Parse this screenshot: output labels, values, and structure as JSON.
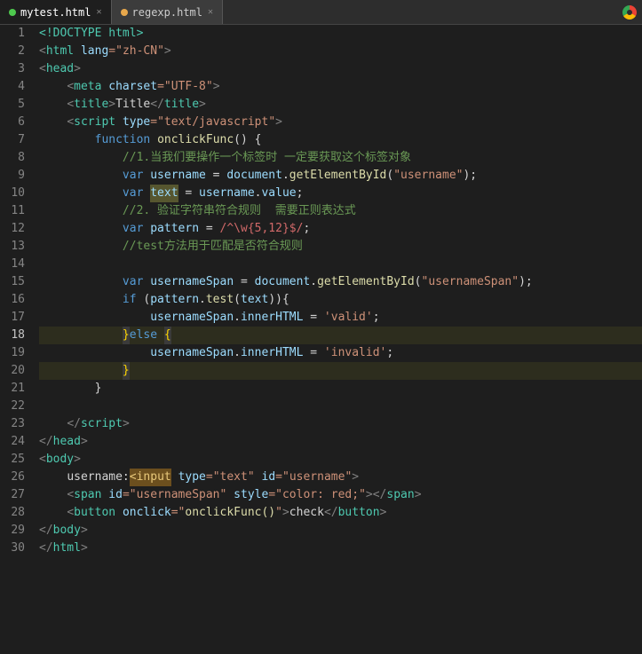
{
  "tabs": [
    {
      "label": "mytest.html",
      "active": true,
      "dot_color": "green"
    },
    {
      "label": "regexp.html",
      "active": false,
      "dot_color": "orange"
    }
  ],
  "lines": [
    {
      "num": 1,
      "tokens": [
        {
          "t": "<!DOCTYPE html>",
          "c": "tag"
        }
      ]
    },
    {
      "num": 2,
      "tokens": [
        {
          "t": "<",
          "c": "tag-bracket"
        },
        {
          "t": "html",
          "c": "tag"
        },
        {
          "t": " ",
          "c": "plain"
        },
        {
          "t": "lang",
          "c": "attr"
        },
        {
          "t": "=\"",
          "c": "str"
        },
        {
          "t": "zh-CN",
          "c": "str"
        },
        {
          "t": "\"",
          "c": "str"
        },
        {
          "t": ">",
          "c": "tag-bracket"
        }
      ]
    },
    {
      "num": 3,
      "tokens": [
        {
          "t": "<",
          "c": "tag-bracket"
        },
        {
          "t": "head",
          "c": "tag"
        },
        {
          "t": ">",
          "c": "tag-bracket"
        }
      ]
    },
    {
      "num": 4,
      "tokens": [
        {
          "t": "    ",
          "c": "plain"
        },
        {
          "t": "<",
          "c": "tag-bracket"
        },
        {
          "t": "meta",
          "c": "tag"
        },
        {
          "t": " ",
          "c": "plain"
        },
        {
          "t": "charset",
          "c": "attr"
        },
        {
          "t": "=\"",
          "c": "str"
        },
        {
          "t": "UTF-8",
          "c": "str"
        },
        {
          "t": "\"",
          "c": "str"
        },
        {
          "t": ">",
          "c": "tag-bracket"
        }
      ]
    },
    {
      "num": 5,
      "tokens": [
        {
          "t": "    ",
          "c": "plain"
        },
        {
          "t": "<",
          "c": "tag-bracket"
        },
        {
          "t": "title",
          "c": "tag"
        },
        {
          "t": ">",
          "c": "tag-bracket"
        },
        {
          "t": "Title",
          "c": "plain"
        },
        {
          "t": "</",
          "c": "tag-bracket"
        },
        {
          "t": "title",
          "c": "tag"
        },
        {
          "t": ">",
          "c": "tag-bracket"
        }
      ]
    },
    {
      "num": 6,
      "tokens": [
        {
          "t": "    ",
          "c": "plain"
        },
        {
          "t": "<",
          "c": "tag-bracket"
        },
        {
          "t": "script",
          "c": "tag"
        },
        {
          "t": " ",
          "c": "plain"
        },
        {
          "t": "type",
          "c": "attr"
        },
        {
          "t": "=\"",
          "c": "str"
        },
        {
          "t": "text/javascript",
          "c": "str"
        },
        {
          "t": "\"",
          "c": "str"
        },
        {
          "t": ">",
          "c": "tag-bracket"
        }
      ]
    },
    {
      "num": 7,
      "tokens": [
        {
          "t": "        ",
          "c": "plain"
        },
        {
          "t": "function",
          "c": "kw"
        },
        {
          "t": " ",
          "c": "plain"
        },
        {
          "t": "onclickFunc",
          "c": "fn"
        },
        {
          "t": "() {",
          "c": "plain"
        }
      ]
    },
    {
      "num": 8,
      "tokens": [
        {
          "t": "            ",
          "c": "plain"
        },
        {
          "t": "//1.当我们要操作一个标签时 一定要获取这个标签对象",
          "c": "comment-cn"
        }
      ]
    },
    {
      "num": 9,
      "tokens": [
        {
          "t": "            ",
          "c": "plain"
        },
        {
          "t": "var",
          "c": "kw"
        },
        {
          "t": " ",
          "c": "plain"
        },
        {
          "t": "username",
          "c": "var-name"
        },
        {
          "t": " = ",
          "c": "plain"
        },
        {
          "t": "document",
          "c": "var-name"
        },
        {
          "t": ".",
          "c": "plain"
        },
        {
          "t": "getElementById",
          "c": "method"
        },
        {
          "t": "(",
          "c": "plain"
        },
        {
          "t": "\"username\"",
          "c": "str"
        },
        {
          "t": ");",
          "c": "plain"
        }
      ]
    },
    {
      "num": 10,
      "tokens": [
        {
          "t": "            ",
          "c": "plain"
        },
        {
          "t": "var",
          "c": "kw"
        },
        {
          "t": " ",
          "c": "plain"
        },
        {
          "t": "text",
          "c": "var-name",
          "highlight": "yellow"
        },
        {
          "t": " = ",
          "c": "plain"
        },
        {
          "t": "username",
          "c": "var-name"
        },
        {
          "t": ".",
          "c": "plain"
        },
        {
          "t": "value",
          "c": "prop"
        },
        {
          "t": ";",
          "c": "plain"
        }
      ]
    },
    {
      "num": 11,
      "tokens": [
        {
          "t": "            ",
          "c": "plain"
        },
        {
          "t": "//2. 验证字符串符合规则  需要正则表达式",
          "c": "comment-cn"
        }
      ]
    },
    {
      "num": 12,
      "tokens": [
        {
          "t": "            ",
          "c": "plain"
        },
        {
          "t": "var",
          "c": "kw"
        },
        {
          "t": " ",
          "c": "plain"
        },
        {
          "t": "pattern",
          "c": "var-name"
        },
        {
          "t": " = ",
          "c": "plain"
        },
        {
          "t": "/^\\w{5,12}$/",
          "c": "regex"
        },
        {
          "t": ";",
          "c": "plain"
        }
      ]
    },
    {
      "num": 13,
      "tokens": [
        {
          "t": "            ",
          "c": "plain"
        },
        {
          "t": "//test方法用于匹配是否符合规则",
          "c": "comment-cn"
        }
      ]
    },
    {
      "num": 14,
      "tokens": []
    },
    {
      "num": 15,
      "tokens": [
        {
          "t": "            ",
          "c": "plain"
        },
        {
          "t": "var",
          "c": "kw"
        },
        {
          "t": " ",
          "c": "plain"
        },
        {
          "t": "usernameSpan",
          "c": "var-name"
        },
        {
          "t": " = ",
          "c": "plain"
        },
        {
          "t": "document",
          "c": "var-name"
        },
        {
          "t": ".",
          "c": "plain"
        },
        {
          "t": "getElementById",
          "c": "method"
        },
        {
          "t": "(",
          "c": "plain"
        },
        {
          "t": "\"usernameSpan\"",
          "c": "str"
        },
        {
          "t": ");",
          "c": "plain"
        }
      ]
    },
    {
      "num": 16,
      "tokens": [
        {
          "t": "            ",
          "c": "plain"
        },
        {
          "t": "if",
          "c": "kw"
        },
        {
          "t": " (",
          "c": "plain"
        },
        {
          "t": "pattern",
          "c": "var-name"
        },
        {
          "t": ".",
          "c": "plain"
        },
        {
          "t": "test",
          "c": "method"
        },
        {
          "t": "(",
          "c": "plain"
        },
        {
          "t": "text",
          "c": "var-name"
        },
        {
          "t": ")){",
          "c": "plain"
        }
      ]
    },
    {
      "num": 17,
      "tokens": [
        {
          "t": "                ",
          "c": "plain"
        },
        {
          "t": "usernameSpan",
          "c": "var-name"
        },
        {
          "t": ".",
          "c": "plain"
        },
        {
          "t": "innerHTML",
          "c": "prop"
        },
        {
          "t": " = ",
          "c": "plain"
        },
        {
          "t": "'valid'",
          "c": "str"
        },
        {
          "t": ";",
          "c": "plain"
        }
      ]
    },
    {
      "num": 18,
      "tokens": [
        {
          "t": "            ",
          "c": "plain"
        },
        {
          "t": "}",
          "c": "bracket-hl-char"
        },
        {
          "t": "else",
          "c": "kw"
        },
        {
          "t": " ",
          "c": "plain"
        },
        {
          "t": "{",
          "c": "bracket-hl-char"
        }
      ],
      "highlight": true
    },
    {
      "num": 19,
      "tokens": [
        {
          "t": "                ",
          "c": "plain"
        },
        {
          "t": "usernameSpan",
          "c": "var-name"
        },
        {
          "t": ".",
          "c": "plain"
        },
        {
          "t": "innerHTML",
          "c": "prop"
        },
        {
          "t": " = ",
          "c": "plain"
        },
        {
          "t": "'invalid'",
          "c": "str"
        },
        {
          "t": ";",
          "c": "plain"
        }
      ]
    },
    {
      "num": 20,
      "tokens": [
        {
          "t": "            ",
          "c": "plain"
        },
        {
          "t": "}",
          "c": "bracket-hl-char"
        }
      ],
      "bracket_end": true
    },
    {
      "num": 21,
      "tokens": [
        {
          "t": "        ",
          "c": "plain"
        },
        {
          "t": "}",
          "c": "plain"
        }
      ]
    },
    {
      "num": 22,
      "tokens": []
    },
    {
      "num": 23,
      "tokens": [
        {
          "t": "    ",
          "c": "plain"
        },
        {
          "t": "</",
          "c": "tag-bracket"
        },
        {
          "t": "script",
          "c": "tag"
        },
        {
          "t": ">",
          "c": "tag-bracket"
        }
      ]
    },
    {
      "num": 24,
      "tokens": [
        {
          "t": "</",
          "c": "tag-bracket"
        },
        {
          "t": "head",
          "c": "tag"
        },
        {
          "t": ">",
          "c": "tag-bracket"
        }
      ]
    },
    {
      "num": 25,
      "tokens": [
        {
          "t": "<",
          "c": "tag-bracket"
        },
        {
          "t": "body",
          "c": "tag"
        },
        {
          "t": ">",
          "c": "tag-bracket"
        }
      ]
    },
    {
      "num": 26,
      "tokens": [
        {
          "t": "    ",
          "c": "plain"
        },
        {
          "t": "username:",
          "c": "plain"
        },
        {
          "t": "<input",
          "c": "tag",
          "input_hl": true
        },
        {
          "t": " ",
          "c": "plain"
        },
        {
          "t": "type",
          "c": "attr"
        },
        {
          "t": "=\"",
          "c": "str"
        },
        {
          "t": "text",
          "c": "str"
        },
        {
          "t": "\" ",
          "c": "str"
        },
        {
          "t": "id",
          "c": "attr"
        },
        {
          "t": "=\"",
          "c": "str"
        },
        {
          "t": "username",
          "c": "str"
        },
        {
          "t": "\"",
          "c": "str"
        },
        {
          "t": ">",
          "c": "tag-bracket"
        }
      ]
    },
    {
      "num": 27,
      "tokens": [
        {
          "t": "    ",
          "c": "plain"
        },
        {
          "t": "<",
          "c": "tag-bracket"
        },
        {
          "t": "span",
          "c": "tag"
        },
        {
          "t": " ",
          "c": "plain"
        },
        {
          "t": "id",
          "c": "attr"
        },
        {
          "t": "=\"",
          "c": "str"
        },
        {
          "t": "usernameSpan",
          "c": "str"
        },
        {
          "t": "\" ",
          "c": "str"
        },
        {
          "t": "style",
          "c": "attr"
        },
        {
          "t": "=\"",
          "c": "str"
        },
        {
          "t": "color: red;",
          "c": "str"
        },
        {
          "t": "\"",
          "c": "str"
        },
        {
          "t": "></",
          "c": "tag-bracket"
        },
        {
          "t": "span",
          "c": "tag"
        },
        {
          "t": ">",
          "c": "tag-bracket"
        }
      ]
    },
    {
      "num": 28,
      "tokens": [
        {
          "t": "    ",
          "c": "plain"
        },
        {
          "t": "<",
          "c": "tag-bracket"
        },
        {
          "t": "button",
          "c": "tag"
        },
        {
          "t": " ",
          "c": "plain"
        },
        {
          "t": "onclick",
          "c": "attr"
        },
        {
          "t": "=\"",
          "c": "str"
        },
        {
          "t": "onclickFunc()",
          "c": "fn-str"
        },
        {
          "t": "\"",
          "c": "str"
        },
        {
          "t": ">",
          "c": "tag-bracket"
        },
        {
          "t": "check",
          "c": "plain"
        },
        {
          "t": "</",
          "c": "tag-bracket"
        },
        {
          "t": "button",
          "c": "tag"
        },
        {
          "t": ">",
          "c": "tag-bracket"
        }
      ]
    },
    {
      "num": 29,
      "tokens": [
        {
          "t": "</",
          "c": "tag-bracket"
        },
        {
          "t": "body",
          "c": "tag"
        },
        {
          "t": ">",
          "c": "tag-bracket"
        }
      ]
    },
    {
      "num": 30,
      "tokens": [
        {
          "t": "</",
          "c": "tag-bracket"
        },
        {
          "t": "html",
          "c": "tag"
        },
        {
          "t": ">",
          "c": "tag-bracket"
        }
      ]
    }
  ]
}
